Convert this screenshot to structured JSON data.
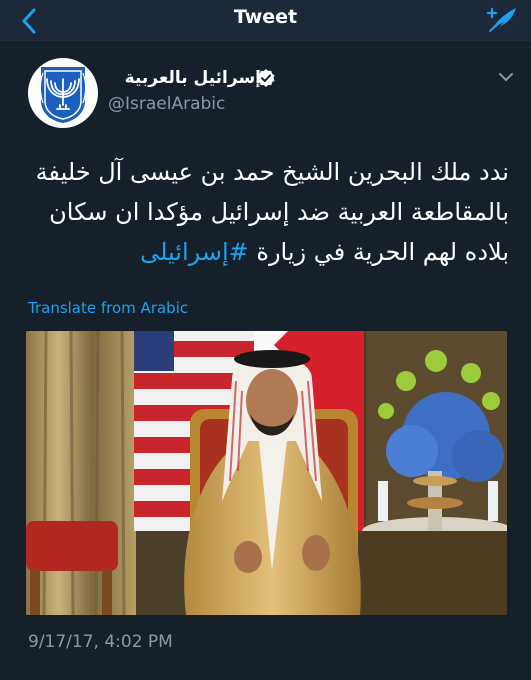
{
  "nav": {
    "title": "Tweet",
    "back_icon": "chevron-left-icon",
    "compose_icon": "feather-compose-icon",
    "accent": "#1da1f2"
  },
  "author": {
    "name": "إسرائيل بالعربية",
    "handle": "@IsraelArabic",
    "verified": true,
    "avatar_icon": "menorah-emblem-icon"
  },
  "tweet": {
    "lines": [
      "ندد ملك البحرين الشيخ حمد بن عيسى آل خليفة",
      "بالمقاطعة العربية ضد إسرائيل مؤكدا ان سكان",
      "بلاده لهم الحرية في زيارة"
    ],
    "hashtag": "#إسرائيلى"
  },
  "translate_label": "Translate from Arabic",
  "timestamp": "9/17/17, 4:02 PM",
  "colors": {
    "background": "#15202b",
    "secondary_text": "#8899a6",
    "link": "#1da1f2"
  }
}
